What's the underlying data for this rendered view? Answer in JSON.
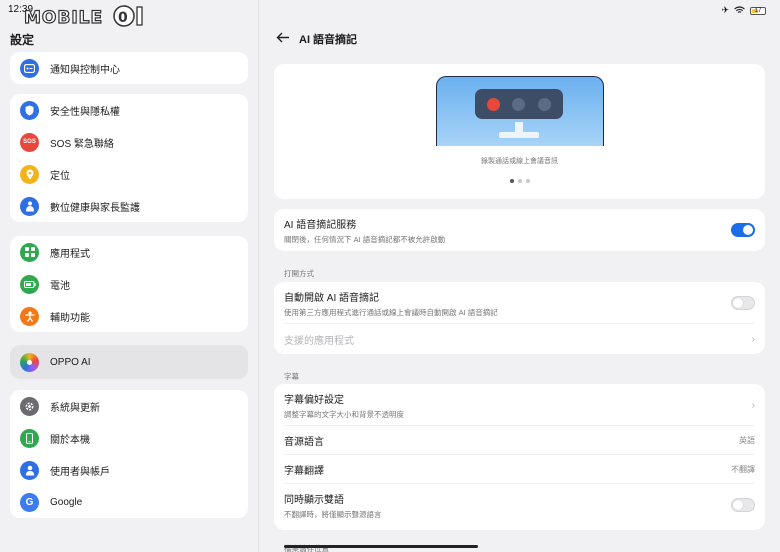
{
  "status": {
    "time": "12:39",
    "battery": "17"
  },
  "watermark": {
    "text": "MOBILE01"
  },
  "settings": {
    "title": "設定",
    "groups": [
      {
        "items": [
          {
            "label": "通知與控制中心",
            "icon": "notification-icon",
            "color": "#2f6fe4"
          }
        ]
      },
      {
        "items": [
          {
            "label": "安全性與隱私權",
            "icon": "shield-icon",
            "color": "#2f6fe4"
          },
          {
            "label": "SOS 緊急聯絡",
            "icon": "sos-icon",
            "color": "#e8473c",
            "glyph": "SOS"
          },
          {
            "label": "定位",
            "icon": "location-icon",
            "color": "#f2b41c"
          },
          {
            "label": "數位健康與家長監護",
            "icon": "wellbeing-icon",
            "color": "#2f6fe4"
          }
        ]
      },
      {
        "items": [
          {
            "label": "應用程式",
            "icon": "apps-icon",
            "color": "#2fa84f"
          },
          {
            "label": "電池",
            "icon": "battery-icon",
            "color": "#2fa84f"
          },
          {
            "label": "輔助功能",
            "icon": "accessibility-icon",
            "color": "#f07a1a"
          }
        ]
      },
      {
        "items": [
          {
            "label": "OPPO AI",
            "icon": "oppo-ai-icon",
            "color": "#9b5cf0",
            "active": true
          }
        ]
      },
      {
        "items": [
          {
            "label": "系統與更新",
            "icon": "gear-icon",
            "color": "#6b6b70"
          },
          {
            "label": "關於本機",
            "icon": "phone-icon",
            "color": "#2fa84f"
          },
          {
            "label": "使用者與帳戶",
            "icon": "user-icon",
            "color": "#2f6fe4"
          },
          {
            "label": "Google",
            "icon": "google-icon",
            "color": "#3b7cf0",
            "glyph": "G"
          }
        ]
      }
    ]
  },
  "page": {
    "title": "AI 語音摘記",
    "hero_caption": "錄製通話或線上會議音訊",
    "carousel_pages": 3,
    "service": {
      "title": "AI 語音摘記服務",
      "subtitle": "關閉後，任何情況下 AI 語音摘記都不被允許啟動",
      "enabled": true
    },
    "open_section": "打開方式",
    "auto_open": {
      "title": "自動開啟 AI 語音摘記",
      "subtitle": "使用第三方應用程式進行通話或線上會議時自動開啟 AI 語音摘記",
      "enabled": false
    },
    "supported_apps": "支援的應用程式",
    "subtitle_section": "字幕",
    "subtitle_prefs": {
      "title": "字幕偏好設定",
      "subtitle": "調整字幕的文字大小和背景不透明度"
    },
    "source_language": {
      "title": "音源語言",
      "value": "英語"
    },
    "subtitle_translation": {
      "title": "字幕翻譯",
      "value": "不翻譯"
    },
    "bilingual": {
      "title": "同時顯示雙語",
      "subtitle": "不翻譯時，將僅顯示聲源語言",
      "enabled": false
    },
    "storage_section": "檔案儲存位置"
  }
}
